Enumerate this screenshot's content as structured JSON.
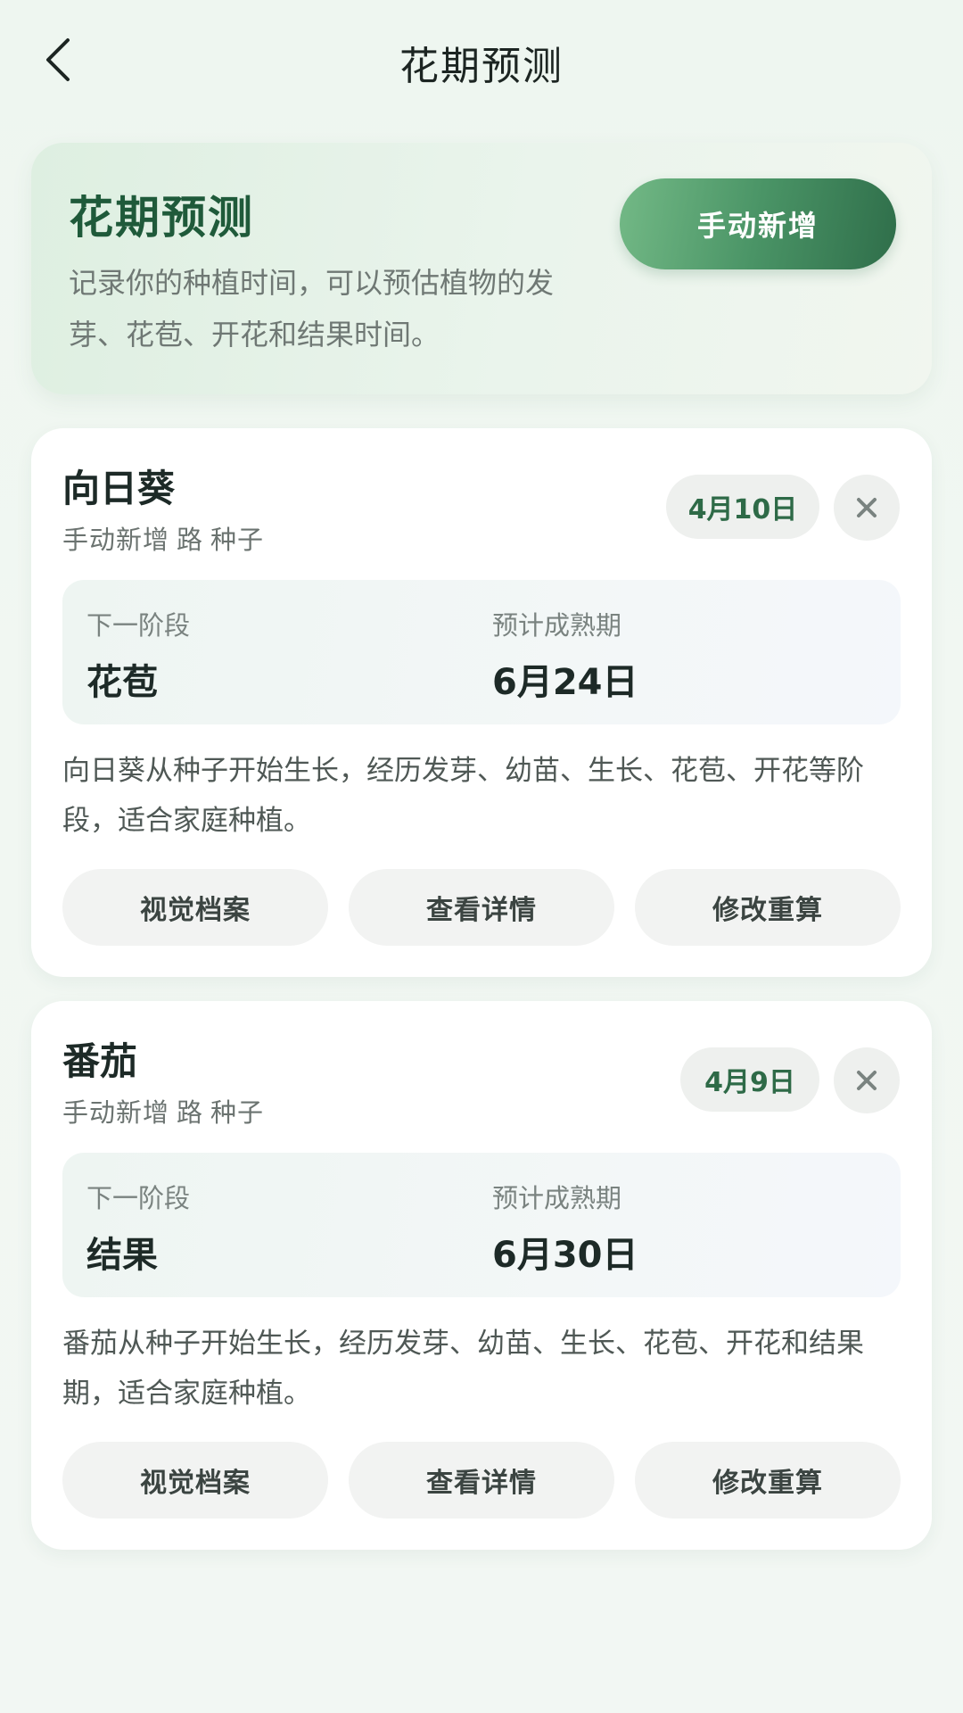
{
  "header": {
    "title": "花期预测"
  },
  "hero": {
    "title": "花期预测",
    "description": "记录你的种植时间，可以预估植物的发芽、花苞、开花和结果时间。",
    "add_button_label": "手动新增"
  },
  "plants": [
    {
      "name": "向日葵",
      "source": "手动新增",
      "separator": "路",
      "type": "种子",
      "date_badge": "4月10日",
      "next_stage_label": "下一阶段",
      "next_stage_value": "花苞",
      "maturity_label": "预计成熟期",
      "maturity_value": "6月24日",
      "description": "向日葵从种子开始生长，经历发芽、幼苗、生长、花苞、开花等阶段，适合家庭种植。",
      "actions": [
        "视觉档案",
        "查看详情",
        "修改重算"
      ]
    },
    {
      "name": "番茄",
      "source": "手动新增",
      "separator": "路",
      "type": "种子",
      "date_badge": "4月9日",
      "next_stage_label": "下一阶段",
      "next_stage_value": "结果",
      "maturity_label": "预计成熟期",
      "maturity_value": "6月30日",
      "description": "番茄从种子开始生长，经历发芽、幼苗、生长、花苞、开花和结果期，适合家庭种植。",
      "actions": [
        "视觉档案",
        "查看详情",
        "修改重算"
      ]
    }
  ],
  "icons": {
    "back": "chevron-left-icon",
    "close": "close-icon"
  },
  "colors": {
    "brand_green": "#2f6e4a",
    "title_green": "#1f5a3a",
    "background": "#eef6f0"
  }
}
